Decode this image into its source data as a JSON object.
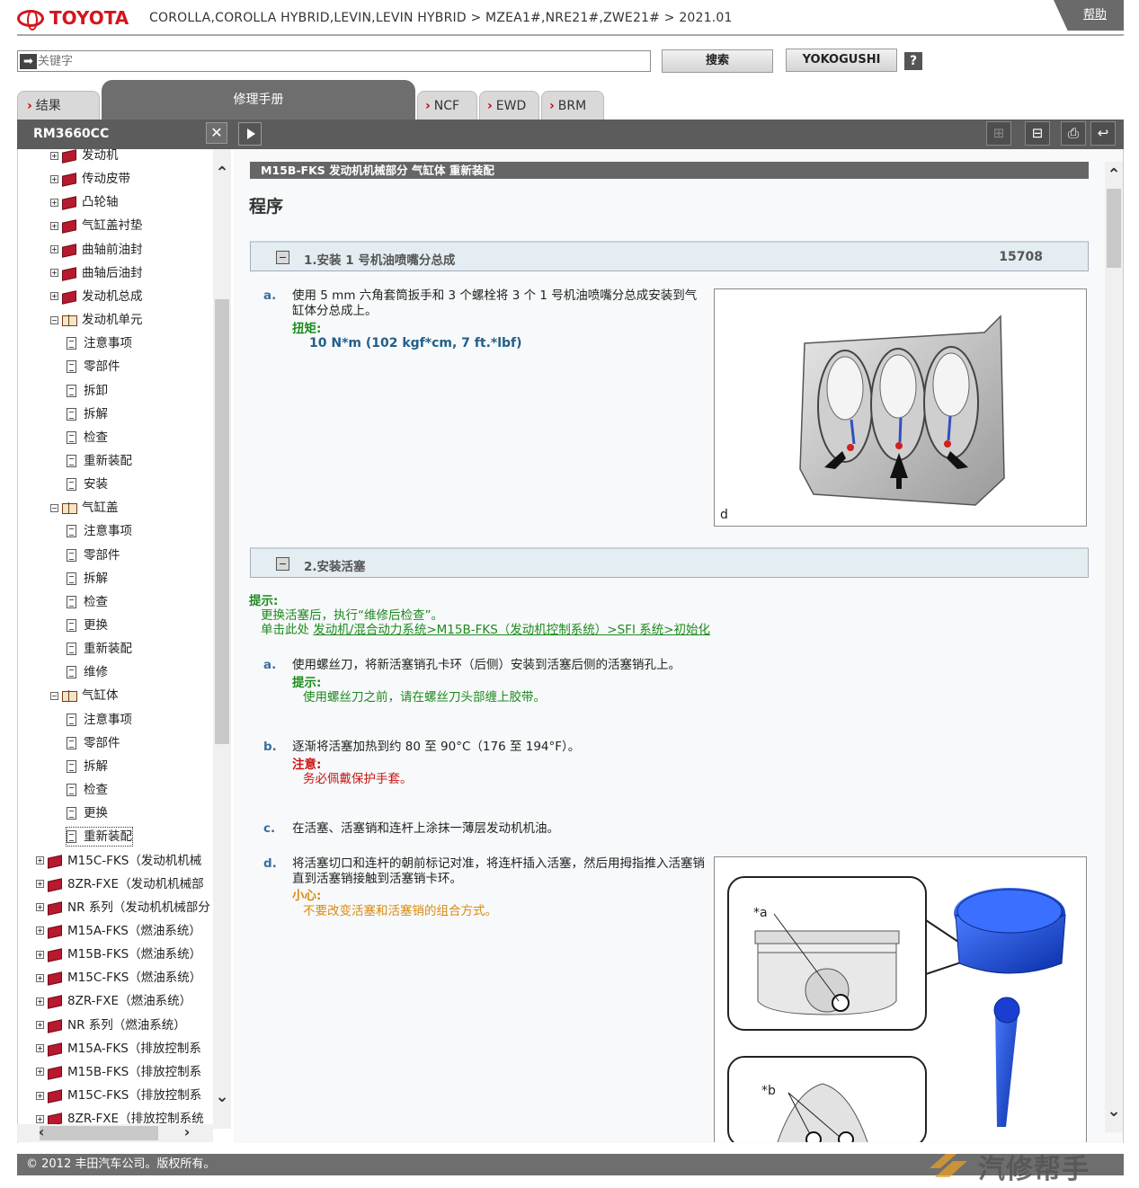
{
  "header": {
    "brand": "TOYOTA",
    "breadcrumb": "COROLLA,COROLLA HYBRID,LEVIN,LEVIN HYBRID > MZEA1#,NRE21#,ZWE21# > 2021.01",
    "help": "帮助"
  },
  "search": {
    "placeholder": "关键字",
    "search_button": "搜索",
    "yokogushi_button": "YOKOGUSHI",
    "help_button": "?"
  },
  "tabs": {
    "results": "结果",
    "manual": "修理手册",
    "ncf": "NCF",
    "ewd": "EWD",
    "brm": "BRM"
  },
  "toc": {
    "id": "RM3660CC",
    "close": "✕",
    "items": [
      {
        "label": "发动机",
        "type": "book"
      },
      {
        "label": "传动皮带",
        "type": "book"
      },
      {
        "label": "凸轮轴",
        "type": "book"
      },
      {
        "label": "气缸盖衬垫",
        "type": "book"
      },
      {
        "label": "曲轴前油封",
        "type": "book"
      },
      {
        "label": "曲轴后油封",
        "type": "book"
      },
      {
        "label": "发动机总成",
        "type": "book"
      },
      {
        "label": "发动机单元",
        "type": "open"
      },
      {
        "label": "注意事项",
        "type": "doc"
      },
      {
        "label": "零部件",
        "type": "doc"
      },
      {
        "label": "拆卸",
        "type": "doc"
      },
      {
        "label": "拆解",
        "type": "doc"
      },
      {
        "label": "检查",
        "type": "doc"
      },
      {
        "label": "重新装配",
        "type": "doc"
      },
      {
        "label": "安装",
        "type": "doc"
      },
      {
        "label": "气缸盖",
        "type": "open"
      },
      {
        "label": "注意事项",
        "type": "doc"
      },
      {
        "label": "零部件",
        "type": "doc"
      },
      {
        "label": "拆解",
        "type": "doc"
      },
      {
        "label": "检查",
        "type": "doc"
      },
      {
        "label": "更换",
        "type": "doc"
      },
      {
        "label": "重新装配",
        "type": "doc"
      },
      {
        "label": "维修",
        "type": "doc"
      },
      {
        "label": "气缸体",
        "type": "open"
      },
      {
        "label": "注意事项",
        "type": "doc"
      },
      {
        "label": "零部件",
        "type": "doc"
      },
      {
        "label": "拆解",
        "type": "doc"
      },
      {
        "label": "检查",
        "type": "doc"
      },
      {
        "label": "更换",
        "type": "doc"
      },
      {
        "label": "重新装配",
        "type": "doc"
      },
      {
        "label": "M15C-FKS（发动机机械",
        "type": "top"
      },
      {
        "label": "8ZR-FXE（发动机机械部",
        "type": "top"
      },
      {
        "label": "NR 系列（发动机机械部分",
        "type": "top"
      },
      {
        "label": "M15A-FKS（燃油系统）",
        "type": "top"
      },
      {
        "label": "M15B-FKS（燃油系统）",
        "type": "top"
      },
      {
        "label": "M15C-FKS（燃油系统）",
        "type": "top"
      },
      {
        "label": "8ZR-FXE（燃油系统）",
        "type": "top"
      },
      {
        "label": "NR 系列（燃油系统）",
        "type": "top"
      },
      {
        "label": "M15A-FKS（排放控制系",
        "type": "top"
      },
      {
        "label": "M15B-FKS（排放控制系",
        "type": "top"
      },
      {
        "label": "M15C-FKS（排放控制系",
        "type": "top"
      },
      {
        "label": "8ZR-FXE（排放控制系统",
        "type": "top"
      }
    ]
  },
  "content": {
    "title": "M15B-FKS 发动机机械部分  气缸体  重新装配",
    "procedure": "程序",
    "step1": {
      "title": "1.安装 1 号机油喷嘴分总成",
      "number": "15708",
      "a_label": "a.",
      "a_text": "使用 5 mm 六角套筒扳手和 3 个螺栓将 3 个 1 号机油喷嘴分总成安装到气缸体分总成上。",
      "torque_label": "扭矩:",
      "torque_value": "10 N*m (102 kgf*cm, 7 ft.*lbf)",
      "fig_label": "d"
    },
    "step2": {
      "title": "2.安装活塞",
      "hint_label": "提示:",
      "hint_line1": "更换活塞后，执行“维修后检查”。",
      "hint_prefix": "单击此处 ",
      "hint_link": "发动机/混合动力系统>M15B-FKS（发动机控制系统）>SFI 系统>初始化",
      "a_label": "a.",
      "a_text": "使用螺丝刀，将新活塞销孔卡环（后侧）安装到活塞后侧的活塞销孔上。",
      "a_hint_label": "提示:",
      "a_hint": "使用螺丝刀之前，请在螺丝刀头部缠上胶带。",
      "b_label": "b.",
      "b_text": "逐渐将活塞加热到约 80 至 90°C（176 至 194°F）。",
      "b_note_label": "注意:",
      "b_note": "务必佩戴保护手套。",
      "c_label": "c.",
      "c_text": "在活塞、活塞销和连杆上涂抹一薄层发动机机油。",
      "d_label": "d.",
      "d_text": "将活塞切口和连杆的朝前标记对准，将连杆插入活塞，然后用拇指推入活塞销直到活塞销接触到活塞销卡环。",
      "d_care_label": "小心:",
      "d_care": "不要改变活塞和活塞销的组合方式。",
      "fig_a": "*a",
      "fig_b": "*b"
    }
  },
  "footer": {
    "copyright": "© 2012 丰田汽车公司。版权所有。",
    "watermark": "汽修帮手"
  }
}
